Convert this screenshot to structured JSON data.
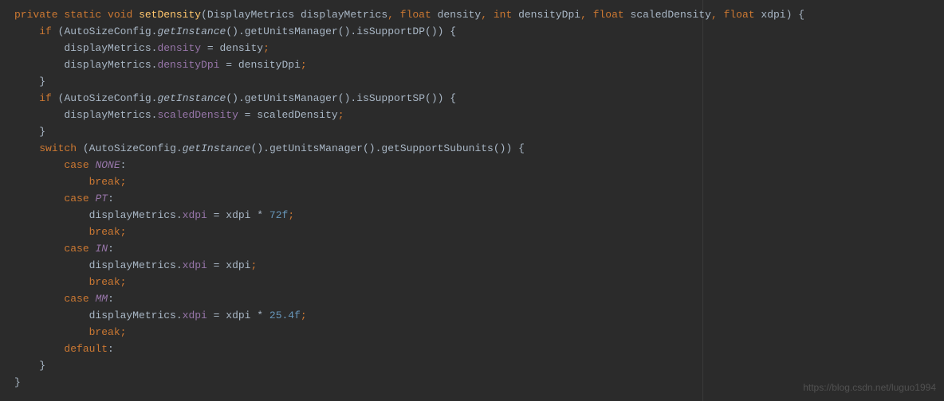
{
  "code": {
    "kw_private": "private",
    "kw_static": "static",
    "kw_void": "void",
    "method_name": "setDensity",
    "type_DisplayMetrics": "DisplayMetrics",
    "param_displayMetrics": "displayMetrics",
    "kw_float": "float",
    "param_density": "density",
    "kw_int": "int",
    "param_densityDpi": "densityDpi",
    "param_scaledDensity": "scaledDensity",
    "param_xdpi": "xdpi",
    "kw_if": "if",
    "class_AutoSizeConfig": "AutoSizeConfig",
    "method_getInstance": "getInstance",
    "method_getUnitsManager": "getUnitsManager",
    "method_isSupportDP": "isSupportDP",
    "method_isSupportSP": "isSupportSP",
    "method_getSupportSubunits": "getSupportSubunits",
    "field_density": "density",
    "field_densityDpi": "densityDpi",
    "field_scaledDensity": "scaledDensity",
    "field_xdpi": "xdpi",
    "kw_switch": "switch",
    "kw_case": "case",
    "kw_break": "break",
    "kw_default": "default",
    "const_NONE": "NONE",
    "const_PT": "PT",
    "const_IN": "IN",
    "const_MM": "MM",
    "num_72f": "72f",
    "num_25_4f": "25.4f",
    "op_assign": " = ",
    "op_mult": " * ",
    "semi": ";",
    "colon": ":",
    "lparen": "(",
    "rparen": ")",
    "lbrace": "{",
    "rbrace": "}",
    "dot": ".",
    "comma": ","
  },
  "watermark": "https://blog.csdn.net/luguo1994"
}
